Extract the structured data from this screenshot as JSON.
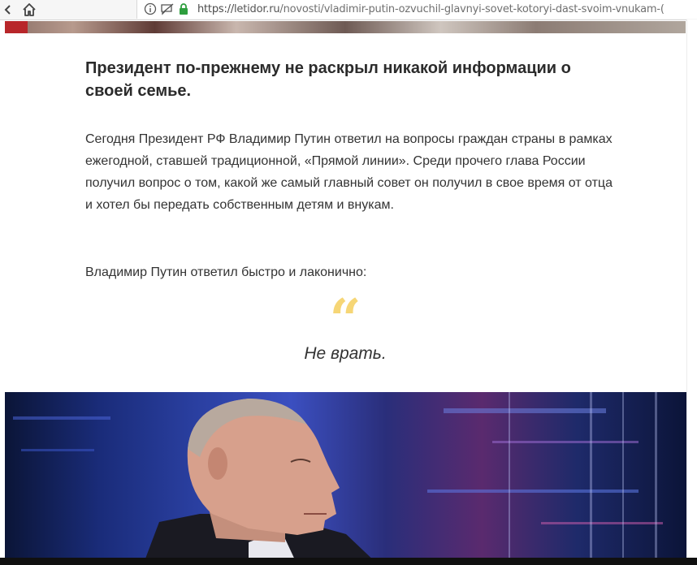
{
  "browser": {
    "url_scheme": "https://",
    "url_host": "letidor.ru",
    "url_path": "/novosti/vladimir-putin-ozvuchil-glavnyi-sovet-kotoryi-dast-svoim-vnukam-("
  },
  "article": {
    "heading": "Президент по-прежнему не раскрыл никакой информации о своей семье.",
    "paragraph1": "Сегодня Президент РФ Владимир Путин ответил на вопросы граждан страны в рамках ежегодной, ставшей традиционной, «Прямой линии». Среди прочего глава России получил вопрос о том, какой же самый главный совет он получил в свое время от отца и хотел бы передать собственным детям и внукам.",
    "paragraph2": "Владимир Путин ответил быстро и лаконично:",
    "quote_mark": "“",
    "quote": "Не врать."
  },
  "colors": {
    "quote_mark": "#f6d676",
    "lock_green": "#2e9e3e"
  }
}
